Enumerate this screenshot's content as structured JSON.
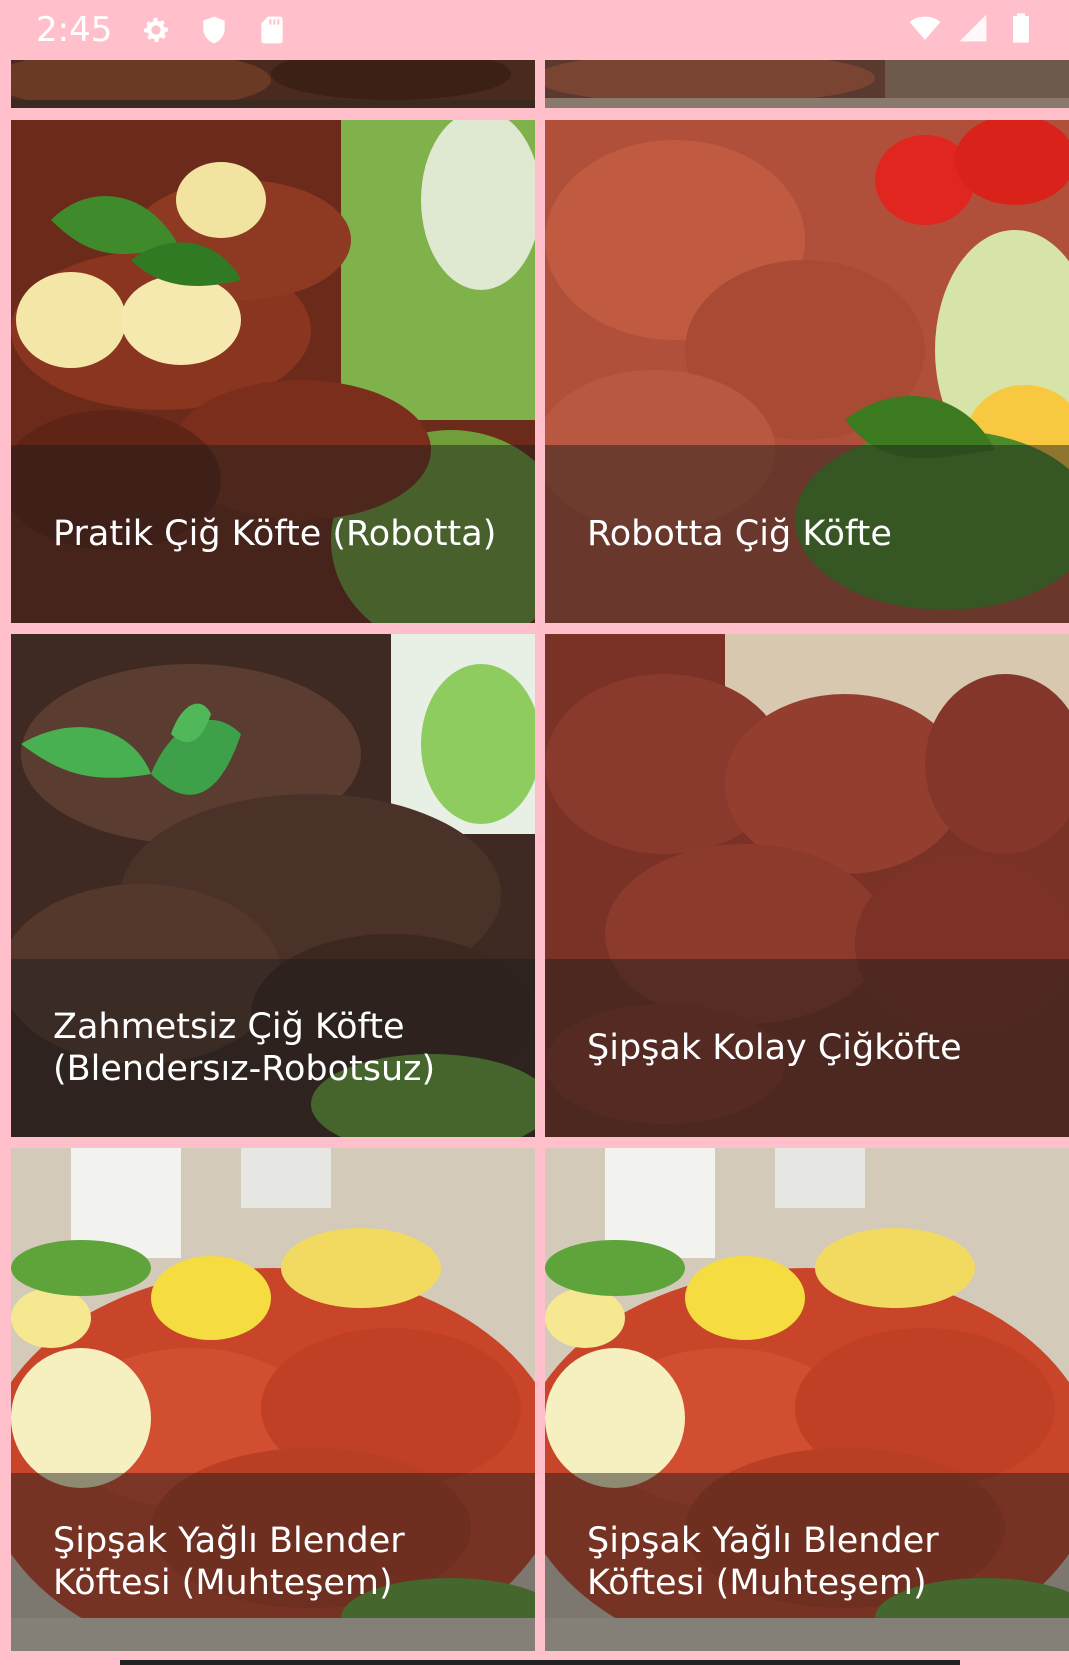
{
  "status_bar": {
    "time": "2:45",
    "left_icons": [
      "gear-icon",
      "shield-icon",
      "sd-card-icon"
    ],
    "right_icons": [
      "wifi-icon",
      "signal-icon",
      "battery-icon"
    ]
  },
  "recipes": [
    {
      "title": "Pratik Çiğ Köfte (Robotta)"
    },
    {
      "title": "Robotta Çiğ Köfte"
    },
    {
      "title": "Zahmetsiz Çiğ Köfte (Blendersız-Robotsuz)"
    },
    {
      "title": "Şipşak Kolay Çiğköfte"
    },
    {
      "title": "Şipşak Yağlı Blender Köftesi (Muhteşem)"
    },
    {
      "title": "Şipşak Yağlı Blender Köftesi (Muhteşem)"
    }
  ],
  "colors": {
    "background": "#ffc0cb",
    "caption_overlay": "rgba(30,30,30,0.48)"
  }
}
